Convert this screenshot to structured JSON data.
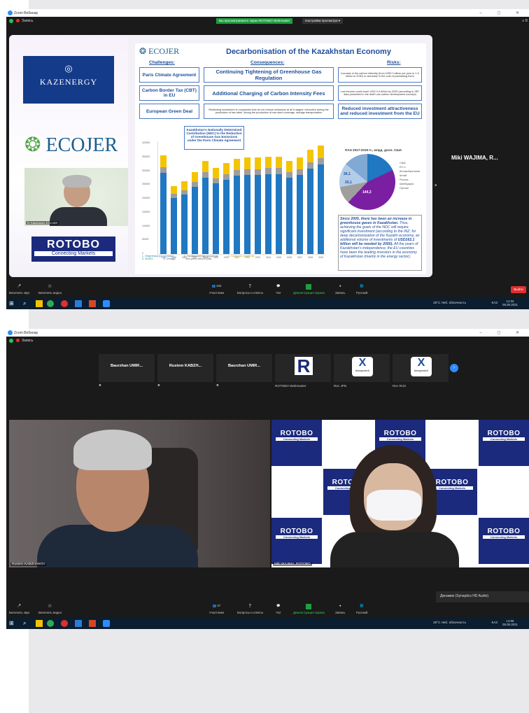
{
  "shot1": {
    "titlebar": {
      "app_title": "Zoom Вебинар",
      "controls": "– ◻ ✕"
    },
    "topbar": {
      "record_label": "Запись",
      "viewing_badge": "Вы просматриваете экран ROTOBO Webmaster",
      "view_options": "Настройки просмотра ▾",
      "view_right": "≡ В"
    },
    "slide": {
      "kazenergy": "KAZENERGY",
      "ecojer": "ECOJER",
      "ecojer_small": "ECOJER",
      "speaker_tag": "R. Kabzhanov, ECOJER",
      "rotobo_main": "ROTOBO",
      "rotobo_sub": "Connecting Markets",
      "title": "Decarbonisation of the Kazakhstan Economy",
      "headers": {
        "challenges": "Challenges:",
        "consequences": "Consequences:",
        "risks": "Risks:"
      },
      "challenges": [
        "Paris Climate Agreement",
        "Carbon Border Tax (CBT) in EU",
        "European Green Deal"
      ],
      "consequences": [
        "Continuing Tightening of Greenhouse Gas Regulation",
        "Additional Charging of Carbon Intensity Fees",
        "Restricting investment to companies that do not reduce emissions at all 5 stages: extraction during the production of raw steel, during the production of raw steel coverage, storage transportation"
      ],
      "risks": [
        "Increase in the carbon intensity (from US$ 2 million per year to 1.5 billion to 2030) or decrease in the cost of purchasing them",
        "Lost income could reach USD 3.4 billion by 2029 (according to ЛЕГ data presented in the draft Low-carbon development concept)",
        "Reduced investment attractiveness and reduced investment from the EU"
      ],
      "callout": "Kazakhstan's Nationally Determined Contribution (NDC) to the Reduction of Greenhouse Gas Emissions under the Paris Climate Agreement",
      "pie_title": "ПАЭ 2017-2019 гг., млрд. долл. США",
      "pie_labels": [
        "144,3",
        "26,1",
        "20,1"
      ],
      "pie_legend": [
        "США",
        "ЕС и Великобритания",
        "Китай",
        "Россия",
        "Швейцария",
        "Прочие"
      ],
      "note_bold": "Since 2005, there has been an increase in greenhouse gases in Kazakhstan.",
      "note_text": "Thus, achieving the goals of the NDC will require significant investment (according to the INZ, for deep decarbonization of the Kazakh economy, an additional volume of investments of",
      "note_bold2": "USD162.1 billion will be needed by 2050).",
      "note_text2": "All the years of Kazakhstan's independence, the EU countries have been the leading investors in the economy of Kazakhstan (mainly in the energy sector).",
      "chart_legend": [
        "1. Энергетика (с/г топливо)",
        "2. Промышленные процессы",
        "4. Сельское хозяйство",
        "5. ЗИЗЛХ",
        "5. Отходы",
        "Без учета ЗИЗЛХ (ИВ)"
      ],
      "y_ticks": [
        "400000",
        "350000",
        "300000",
        "250000",
        "200000",
        "150000",
        "100000",
        "50000",
        "0"
      ],
      "x_ticks": [
        "1990",
        "2005",
        "2006",
        "2007",
        "2008",
        "2009",
        "2010",
        "2011",
        "2012",
        "2013",
        "2014",
        "2015",
        "2016",
        "2017",
        "2018",
        "2019"
      ]
    },
    "side_name": "Miki WAJIMA, R...",
    "toolbar": {
      "unmute": "Включить звук",
      "video": "Включить видео",
      "participants": "Участники",
      "participants_count": "334",
      "qa": "Вопросы и ответы",
      "chat": "Чат",
      "share": "Демонстрация экрана",
      "record": "Запись",
      "lang": "Русский",
      "leave": "Выйти"
    },
    "taskbar": {
      "weather": "26°C  Неб. облачность",
      "lang": "КАЗ",
      "time": "14:34",
      "date": "05.08.2021"
    }
  },
  "shot2": {
    "titlebar": {
      "app_title": "Zoom Вебинар",
      "controls": "– ◻ ✕"
    },
    "topbar": {
      "record_label": "Запись"
    },
    "strip": [
      {
        "name": "Baurzhan UMIR...",
        "sub": ""
      },
      {
        "name": "Rustem KABZH...",
        "sub": ""
      },
      {
        "name": "Baurzhan UMIR...",
        "sub": ""
      },
      {
        "name": "R",
        "sub": "ROTOBO Webmaster"
      },
      {
        "name": "X",
        "sub": "Rec JPN"
      },
      {
        "name": "X",
        "sub": "Rec RUS"
      }
    ],
    "video1_tag": "Rustem KABZHANOV",
    "video2_tag": "Miki WAJIMA, ROTOBO",
    "rotobo_tile": {
      "main": "ROTOBO",
      "sub": "Connecting Markets"
    },
    "audio": {
      "label": "Динамик (Synaptics HD Audio)",
      "level": 35
    },
    "toolbar": {
      "unmute": "Включить звук",
      "video": "Включить видео",
      "participants": "Участники",
      "participants_count": "67",
      "qa": "Вопросы и ответы",
      "chat": "Чат",
      "share": "Демонстрация экрана",
      "record": "Запись",
      "lang": "Русский"
    },
    "taskbar": {
      "weather": "26°C  Неб. облачность",
      "lang": "КАЗ",
      "time": "14:56",
      "date": "05.08.2021"
    }
  }
}
